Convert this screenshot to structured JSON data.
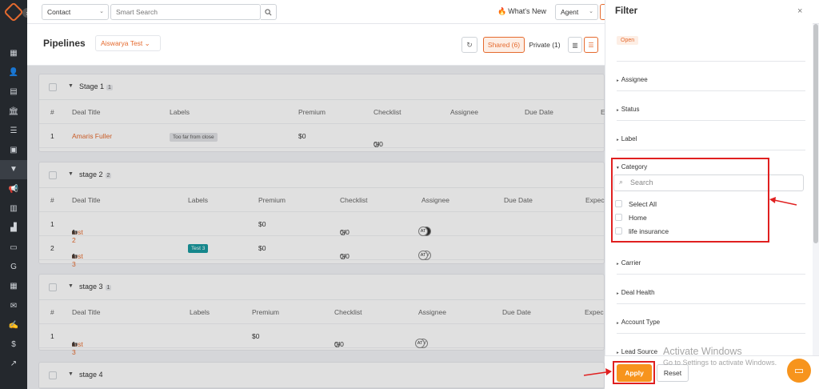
{
  "sidebar": {
    "collapse_glyph": "›",
    "items": [
      {
        "icon": "dashboard-icon",
        "glyph": "▦"
      },
      {
        "icon": "contacts-icon",
        "glyph": "👤"
      },
      {
        "icon": "documents-icon",
        "glyph": "▤"
      },
      {
        "icon": "bank-icon",
        "glyph": "🏛"
      },
      {
        "icon": "list-icon",
        "glyph": "☰"
      },
      {
        "icon": "contact-card-icon",
        "glyph": "▣"
      },
      {
        "icon": "pipeline-filter-icon",
        "glyph": "▼",
        "active": true
      },
      {
        "icon": "megaphone-icon",
        "glyph": "📢"
      },
      {
        "icon": "notebook-icon",
        "glyph": "▥"
      },
      {
        "icon": "reports-icon",
        "glyph": "▟"
      },
      {
        "icon": "folder-icon",
        "glyph": "▭"
      },
      {
        "icon": "google-icon",
        "glyph": "G"
      },
      {
        "icon": "calendar-icon",
        "glyph": "▦"
      },
      {
        "icon": "mail-icon",
        "glyph": "✉"
      },
      {
        "icon": "signature-icon",
        "glyph": "✍"
      },
      {
        "icon": "dollar-icon",
        "glyph": "$"
      },
      {
        "icon": "trend-icon",
        "glyph": "↗"
      }
    ]
  },
  "topbar": {
    "contact_select": "Contact",
    "search_placeholder": "Smart Search",
    "whats_new": "What's New",
    "agent_select": "Agent"
  },
  "header": {
    "title": "Pipelines",
    "pipeline_name": "Aiswarya Test",
    "shared_label": "Shared (6)",
    "private_label": "Private (1)"
  },
  "stages": [
    {
      "name": "Stage 1",
      "count": "1",
      "columns": [
        "#",
        "Deal Title",
        "Labels",
        "Premium",
        "Checklist",
        "Assignee",
        "Due Date",
        "E"
      ],
      "rows": [
        {
          "num": "1",
          "title": "Amaris Fuller",
          "label": "Too far from close",
          "premium": "$0",
          "checklist": "0/0"
        }
      ]
    },
    {
      "name": "stage 2",
      "count": "2",
      "columns": [
        "#",
        "Deal Title",
        "Labels",
        "Premium",
        "Checklist",
        "Assignee",
        "Due Date",
        "Expec"
      ],
      "rows": [
        {
          "num": "1",
          "title": "test 2",
          "sub": "1",
          "label": "",
          "premium": "$0",
          "checklist": "0/0",
          "assignees": [
            "",
            "AT"
          ]
        },
        {
          "num": "2",
          "title": "test 3",
          "sub": "1",
          "label": "Test 3",
          "premium": "$0",
          "checklist": "0/0",
          "assignees": [
            "SV",
            "AT"
          ]
        }
      ]
    },
    {
      "name": "stage 3",
      "count": "1",
      "columns": [
        "#",
        "Deal Title",
        "Labels",
        "Premium",
        "Checklist",
        "Assignee",
        "Due Date",
        "Expec"
      ],
      "rows": [
        {
          "num": "1",
          "title": "test 3",
          "sub": "1",
          "label": "",
          "premium": "$0",
          "checklist": "0/0",
          "assignees": [
            "SV",
            "AT"
          ]
        }
      ]
    },
    {
      "name": "stage 4",
      "count": "",
      "columns": [],
      "rows": []
    }
  ],
  "filter": {
    "title": "Filter",
    "close": "×",
    "status_chip": "Open",
    "sections": [
      "Assignee",
      "Status",
      "Label"
    ],
    "category": {
      "label": "Category",
      "search_placeholder": "Search",
      "options": [
        "Select All",
        "Home",
        "life insurance"
      ]
    },
    "more_sections": [
      "Carrier",
      "Deal Health",
      "Account Type",
      "Lead Source"
    ],
    "apply": "Apply",
    "reset": "Reset"
  },
  "watermark": {
    "title": "Activate Windows",
    "subtitle": "Go to Settings to activate Windows."
  },
  "colors": {
    "accent": "#e56a2e",
    "apply": "#f7941d",
    "annotation": "#e02020",
    "sidebar": "#24282d"
  }
}
